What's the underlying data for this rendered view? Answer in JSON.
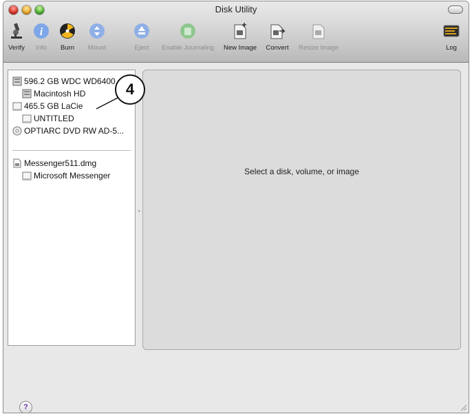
{
  "window": {
    "title": "Disk Utility"
  },
  "toolbar": {
    "items": [
      {
        "label": "Verify",
        "icon": "microscope-icon",
        "enabled": true
      },
      {
        "label": "Info",
        "icon": "info-icon",
        "enabled": false
      },
      {
        "label": "Burn",
        "icon": "burn-icon",
        "enabled": true
      },
      {
        "label": "Mount",
        "icon": "mount-icon",
        "enabled": false
      },
      {
        "label": "Eject",
        "icon": "eject-icon",
        "enabled": false
      },
      {
        "label": "Enable Journaling",
        "icon": "journaling-icon",
        "enabled": false
      },
      {
        "label": "New Image",
        "icon": "new-image-icon",
        "enabled": true
      },
      {
        "label": "Convert",
        "icon": "convert-icon",
        "enabled": true
      },
      {
        "label": "Resize Image",
        "icon": "resize-image-icon",
        "enabled": false
      },
      {
        "label": "Log",
        "icon": "log-icon",
        "enabled": true
      }
    ]
  },
  "sidebar": {
    "items": [
      {
        "label": "596.2 GB WDC WD6400",
        "kind": "internal-disk",
        "indent": false
      },
      {
        "label": "Macintosh HD",
        "kind": "internal-disk",
        "indent": true
      },
      {
        "label": "465.5 GB LaCie",
        "kind": "external-disk",
        "indent": false
      },
      {
        "label": "UNTITLED",
        "kind": "external-disk",
        "indent": true
      },
      {
        "label": "OPTIARC DVD RW AD-5...",
        "kind": "optical-drive",
        "indent": false
      },
      {
        "label": "Messenger511.dmg",
        "kind": "disk-image",
        "indent": false
      },
      {
        "label": "Microsoft Messenger",
        "kind": "external-disk",
        "indent": true
      }
    ]
  },
  "main": {
    "placeholder": "Select a disk, volume, or image"
  },
  "help": {
    "label": "?"
  },
  "callout": {
    "label": "4"
  },
  "colors": {
    "accent": "#3d79d6",
    "burn": "#f2b51c",
    "help": "#6b2fa0"
  }
}
